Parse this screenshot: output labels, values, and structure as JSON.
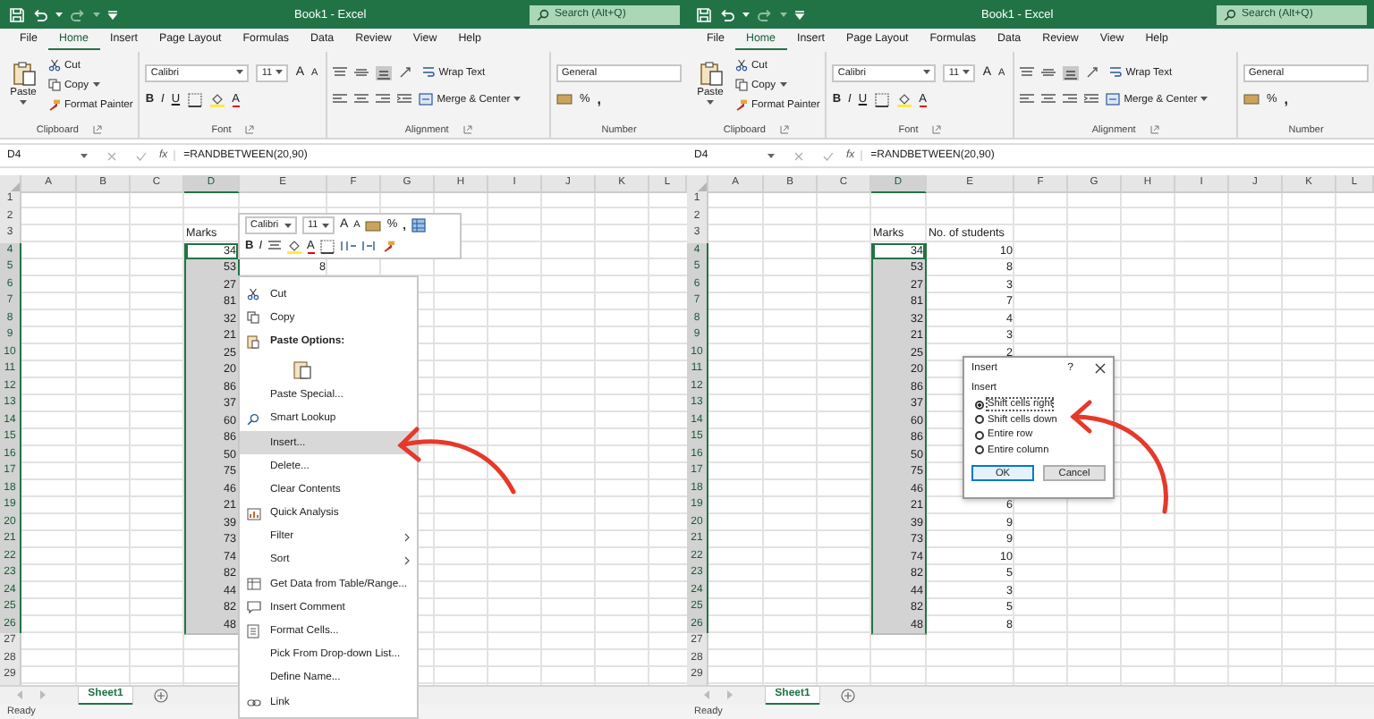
{
  "panes": [
    {
      "title_bar": {
        "title": "Book1 - Excel",
        "search": {
          "placeholder": "Search (Alt+Q)"
        }
      },
      "ribbon_tabs": [
        {
          "label": "File",
          "selected": false
        },
        {
          "label": "Home",
          "selected": true
        },
        {
          "label": "Insert",
          "selected": false
        },
        {
          "label": "Page Layout",
          "selected": false
        },
        {
          "label": "Formulas",
          "selected": false
        },
        {
          "label": "Data",
          "selected": false
        },
        {
          "label": "Review",
          "selected": false
        },
        {
          "label": "View",
          "selected": false
        },
        {
          "label": "Help",
          "selected": false
        }
      ],
      "ribbon": {
        "groups": [
          {
            "kind": "clipboard",
            "label": "Clipboard",
            "paste": "Paste",
            "commands": [
              "Cut",
              "Copy",
              "Format Painter"
            ]
          },
          {
            "kind": "font",
            "label": "Font",
            "font_name": "Calibri",
            "font_size": "11",
            "grow": "A",
            "shrink": "A",
            "styles": [
              "B",
              "I",
              "U"
            ],
            "color_letter": "A"
          },
          {
            "kind": "alignment",
            "label": "Alignment",
            "wrap": "Wrap Text",
            "merge": "Merge & Center"
          },
          {
            "kind": "number",
            "label": "Number",
            "format": "General",
            "percent": "%",
            "comma": ","
          }
        ]
      },
      "formula_bar": {
        "name_box": "D4",
        "function_label": "fx",
        "formula": "=RANDBETWEEN(20,90)"
      },
      "grid": {
        "columns": [
          {
            "label": "A",
            "selected": false
          },
          {
            "label": "B",
            "selected": false
          },
          {
            "label": "C",
            "selected": false
          },
          {
            "label": "D",
            "selected": true
          },
          {
            "label": "E",
            "selected": false
          },
          {
            "label": "F",
            "selected": false
          },
          {
            "label": "G",
            "selected": false
          },
          {
            "label": "H",
            "selected": false
          },
          {
            "label": "I",
            "selected": false
          },
          {
            "label": "J",
            "selected": false
          },
          {
            "label": "K",
            "selected": false
          },
          {
            "label": "L",
            "selected": false
          }
        ],
        "rows": [
          {
            "label": "1",
            "selected": false
          },
          {
            "label": "2",
            "selected": false
          },
          {
            "label": "3",
            "selected": false,
            "d": {
              "kind": "text",
              "text": "Marks",
              "selected": false,
              "active": false
            }
          },
          {
            "label": "4",
            "selected": true,
            "d": {
              "kind": "number",
              "text": "34",
              "selected": true,
              "active": true
            }
          },
          {
            "label": "5",
            "selected": true,
            "d": {
              "kind": "number",
              "text": "53",
              "selected": true,
              "active": false
            },
            "e": {
              "kind": "number",
              "text": "8"
            }
          },
          {
            "label": "6",
            "selected": true,
            "d": {
              "kind": "number",
              "text": "27",
              "selected": true,
              "active": false
            }
          },
          {
            "label": "7",
            "selected": true,
            "d": {
              "kind": "number",
              "text": "81",
              "selected": true,
              "active": false
            }
          },
          {
            "label": "8",
            "selected": true,
            "d": {
              "kind": "number",
              "text": "32",
              "selected": true,
              "active": false
            }
          },
          {
            "label": "9",
            "selected": true,
            "d": {
              "kind": "number",
              "text": "21",
              "selected": true,
              "active": false
            }
          },
          {
            "label": "10",
            "selected": true,
            "d": {
              "kind": "number",
              "text": "25",
              "selected": true,
              "active": false
            }
          },
          {
            "label": "11",
            "selected": true,
            "d": {
              "kind": "number",
              "text": "20",
              "selected": true,
              "active": false
            }
          },
          {
            "label": "12",
            "selected": true,
            "d": {
              "kind": "number",
              "text": "86",
              "selected": true,
              "active": false
            }
          },
          {
            "label": "13",
            "selected": true,
            "d": {
              "kind": "number",
              "text": "37",
              "selected": true,
              "active": false
            }
          },
          {
            "label": "14",
            "selected": true,
            "d": {
              "kind": "number",
              "text": "60",
              "selected": true,
              "active": false
            }
          },
          {
            "label": "15",
            "selected": true,
            "d": {
              "kind": "number",
              "text": "86",
              "selected": true,
              "active": false
            }
          },
          {
            "label": "16",
            "selected": true,
            "d": {
              "kind": "number",
              "text": "50",
              "selected": true,
              "active": false
            }
          },
          {
            "label": "17",
            "selected": true,
            "d": {
              "kind": "number",
              "text": "75",
              "selected": true,
              "active": false
            }
          },
          {
            "label": "18",
            "selected": true,
            "d": {
              "kind": "number",
              "text": "46",
              "selected": true,
              "active": false
            }
          },
          {
            "label": "19",
            "selected": true,
            "d": {
              "kind": "number",
              "text": "21",
              "selected": true,
              "active": false
            }
          },
          {
            "label": "20",
            "selected": true,
            "d": {
              "kind": "number",
              "text": "39",
              "selected": true,
              "active": false
            }
          },
          {
            "label": "21",
            "selected": true,
            "d": {
              "kind": "number",
              "text": "73",
              "selected": true,
              "active": false
            }
          },
          {
            "label": "22",
            "selected": true,
            "d": {
              "kind": "number",
              "text": "74",
              "selected": true,
              "active": false
            }
          },
          {
            "label": "23",
            "selected": true,
            "d": {
              "kind": "number",
              "text": "82",
              "selected": true,
              "active": false
            }
          },
          {
            "label": "24",
            "selected": true,
            "d": {
              "kind": "number",
              "text": "44",
              "selected": true,
              "active": false
            }
          },
          {
            "label": "25",
            "selected": true,
            "d": {
              "kind": "number",
              "text": "82",
              "selected": true,
              "active": false
            }
          },
          {
            "label": "26",
            "selected": true,
            "d": {
              "kind": "number",
              "text": "48",
              "selected": true,
              "active": false
            }
          },
          {
            "label": "27",
            "selected": false
          },
          {
            "label": "28",
            "selected": false
          },
          {
            "label": "29",
            "selected": false
          }
        ]
      },
      "sheet_tabs": [
        {
          "label": "Sheet1",
          "selected": true
        }
      ],
      "status_bar": "Ready",
      "mini_toolbar": {
        "font_name": "Calibri",
        "font_size": "11",
        "grow": "A",
        "shrink": "A",
        "percent": "%",
        "comma": ",",
        "bold": "B",
        "italic": "I",
        "color_letter": "A"
      },
      "context_menu": {
        "items": [
          {
            "kind": "scissors",
            "label": "Cut",
            "selected": false,
            "submenu": false
          },
          {
            "kind": "pages",
            "label": "Copy",
            "selected": false,
            "submenu": false
          },
          {
            "kind": "header",
            "label": "Paste Options:",
            "selected": false,
            "submenu": false
          },
          {
            "kind": "paste",
            "selected": false,
            "submenu": false
          },
          {
            "kind": "plain",
            "label": "Paste Special...",
            "selected": false,
            "submenu": false
          },
          {
            "kind": "magnifier",
            "label": "Smart Lookup",
            "selected": false,
            "submenu": false
          },
          {
            "kind": "plain",
            "label": "Insert...",
            "selected": true,
            "submenu": false
          },
          {
            "kind": "plain",
            "label": "Delete...",
            "selected": false,
            "submenu": false
          },
          {
            "kind": "plain",
            "label": "Clear Contents",
            "selected": false,
            "submenu": false
          },
          {
            "kind": "chart",
            "label": "Quick Analysis",
            "selected": false,
            "submenu": false
          },
          {
            "kind": "plain",
            "label": "Filter",
            "selected": false,
            "submenu": true
          },
          {
            "kind": "plain",
            "label": "Sort",
            "selected": false,
            "submenu": true
          },
          {
            "kind": "table",
            "label": "Get Data from Table/Range...",
            "selected": false,
            "submenu": false
          },
          {
            "kind": "comment",
            "label": "Insert Comment",
            "selected": false,
            "submenu": false
          },
          {
            "kind": "form",
            "label": "Format Cells...",
            "selected": false,
            "submenu": false
          },
          {
            "kind": "plain",
            "label": "Pick From Drop-down List...",
            "selected": false,
            "submenu": false
          },
          {
            "kind": "plain",
            "label": "Define Name...",
            "selected": false,
            "submenu": false
          },
          {
            "kind": "chain",
            "label": "Link",
            "selected": false,
            "submenu": false
          }
        ]
      }
    },
    {
      "title_bar": {
        "title": "Book1 - Excel",
        "search": {
          "placeholder": "Search (Alt+Q)"
        }
      },
      "ribbon_tabs": [
        {
          "label": "File",
          "selected": false
        },
        {
          "label": "Home",
          "selected": true
        },
        {
          "label": "Insert",
          "selected": false
        },
        {
          "label": "Page Layout",
          "selected": false
        },
        {
          "label": "Formulas",
          "selected": false
        },
        {
          "label": "Data",
          "selected": false
        },
        {
          "label": "Review",
          "selected": false
        },
        {
          "label": "View",
          "selected": false
        },
        {
          "label": "Help",
          "selected": false
        }
      ],
      "ribbon": {
        "groups": [
          {
            "kind": "clipboard",
            "label": "Clipboard",
            "paste": "Paste",
            "commands": [
              "Cut",
              "Copy",
              "Format Painter"
            ]
          },
          {
            "kind": "font",
            "label": "Font",
            "font_name": "Calibri",
            "font_size": "11",
            "grow": "A",
            "shrink": "A",
            "styles": [
              "B",
              "I",
              "U"
            ],
            "color_letter": "A"
          },
          {
            "kind": "alignment",
            "label": "Alignment",
            "wrap": "Wrap Text",
            "merge": "Merge & Center"
          },
          {
            "kind": "number",
            "label": "Number",
            "format": "General",
            "percent": "%",
            "comma": ","
          }
        ]
      },
      "formula_bar": {
        "name_box": "D4",
        "function_label": "fx",
        "formula": "=RANDBETWEEN(20,90)"
      },
      "grid": {
        "columns": [
          {
            "label": "A",
            "selected": false
          },
          {
            "label": "B",
            "selected": false
          },
          {
            "label": "C",
            "selected": false
          },
          {
            "label": "D",
            "selected": true
          },
          {
            "label": "E",
            "selected": false
          },
          {
            "label": "F",
            "selected": false
          },
          {
            "label": "G",
            "selected": false
          },
          {
            "label": "H",
            "selected": false
          },
          {
            "label": "I",
            "selected": false
          },
          {
            "label": "J",
            "selected": false
          },
          {
            "label": "K",
            "selected": false
          },
          {
            "label": "L",
            "selected": false
          }
        ],
        "rows": [
          {
            "label": "1",
            "selected": false
          },
          {
            "label": "2",
            "selected": false
          },
          {
            "label": "3",
            "selected": false,
            "d": {
              "kind": "text",
              "text": "Marks",
              "selected": false,
              "active": false
            },
            "e": {
              "kind": "text",
              "text": "No. of students"
            }
          },
          {
            "label": "4",
            "selected": true,
            "d": {
              "kind": "number",
              "text": "34",
              "selected": true,
              "active": true
            },
            "e": {
              "kind": "number",
              "text": "10"
            }
          },
          {
            "label": "5",
            "selected": true,
            "d": {
              "kind": "number",
              "text": "53",
              "selected": true,
              "active": false
            },
            "e": {
              "kind": "number",
              "text": "8"
            }
          },
          {
            "label": "6",
            "selected": true,
            "d": {
              "kind": "number",
              "text": "27",
              "selected": true,
              "active": false
            },
            "e": {
              "kind": "number",
              "text": "3"
            }
          },
          {
            "label": "7",
            "selected": true,
            "d": {
              "kind": "number",
              "text": "81",
              "selected": true,
              "active": false
            },
            "e": {
              "kind": "number",
              "text": "7"
            }
          },
          {
            "label": "8",
            "selected": true,
            "d": {
              "kind": "number",
              "text": "32",
              "selected": true,
              "active": false
            },
            "e": {
              "kind": "number",
              "text": "4"
            }
          },
          {
            "label": "9",
            "selected": true,
            "d": {
              "kind": "number",
              "text": "21",
              "selected": true,
              "active": false
            },
            "e": {
              "kind": "number",
              "text": "3"
            }
          },
          {
            "label": "10",
            "selected": true,
            "d": {
              "kind": "number",
              "text": "25",
              "selected": true,
              "active": false
            },
            "e": {
              "kind": "number",
              "text": "2"
            }
          },
          {
            "label": "11",
            "selected": true,
            "d": {
              "kind": "number",
              "text": "20",
              "selected": true,
              "active": false
            }
          },
          {
            "label": "12",
            "selected": true,
            "d": {
              "kind": "number",
              "text": "86",
              "selected": true,
              "active": false
            }
          },
          {
            "label": "13",
            "selected": true,
            "d": {
              "kind": "number",
              "text": "37",
              "selected": true,
              "active": false
            }
          },
          {
            "label": "14",
            "selected": true,
            "d": {
              "kind": "number",
              "text": "60",
              "selected": true,
              "active": false
            }
          },
          {
            "label": "15",
            "selected": true,
            "d": {
              "kind": "number",
              "text": "86",
              "selected": true,
              "active": false
            }
          },
          {
            "label": "16",
            "selected": true,
            "d": {
              "kind": "number",
              "text": "50",
              "selected": true,
              "active": false
            }
          },
          {
            "label": "17",
            "selected": true,
            "d": {
              "kind": "number",
              "text": "75",
              "selected": true,
              "active": false
            }
          },
          {
            "label": "18",
            "selected": true,
            "d": {
              "kind": "number",
              "text": "46",
              "selected": true,
              "active": false
            }
          },
          {
            "label": "19",
            "selected": true,
            "d": {
              "kind": "number",
              "text": "21",
              "selected": true,
              "active": false
            },
            "e": {
              "kind": "number",
              "text": "6"
            }
          },
          {
            "label": "20",
            "selected": true,
            "d": {
              "kind": "number",
              "text": "39",
              "selected": true,
              "active": false
            },
            "e": {
              "kind": "number",
              "text": "9"
            }
          },
          {
            "label": "21",
            "selected": true,
            "d": {
              "kind": "number",
              "text": "73",
              "selected": true,
              "active": false
            },
            "e": {
              "kind": "number",
              "text": "9"
            }
          },
          {
            "label": "22",
            "selected": true,
            "d": {
              "kind": "number",
              "text": "74",
              "selected": true,
              "active": false
            },
            "e": {
              "kind": "number",
              "text": "10"
            }
          },
          {
            "label": "23",
            "selected": true,
            "d": {
              "kind": "number",
              "text": "82",
              "selected": true,
              "active": false
            },
            "e": {
              "kind": "number",
              "text": "5"
            }
          },
          {
            "label": "24",
            "selected": true,
            "d": {
              "kind": "number",
              "text": "44",
              "selected": true,
              "active": false
            },
            "e": {
              "kind": "number",
              "text": "3"
            }
          },
          {
            "label": "25",
            "selected": true,
            "d": {
              "kind": "number",
              "text": "82",
              "selected": true,
              "active": false
            },
            "e": {
              "kind": "number",
              "text": "5"
            }
          },
          {
            "label": "26",
            "selected": true,
            "d": {
              "kind": "number",
              "text": "48",
              "selected": true,
              "active": false
            },
            "e": {
              "kind": "number",
              "text": "8"
            }
          },
          {
            "label": "27",
            "selected": false
          },
          {
            "label": "28",
            "selected": false
          },
          {
            "label": "29",
            "selected": false
          }
        ]
      },
      "sheet_tabs": [
        {
          "label": "Sheet1",
          "selected": true
        }
      ],
      "status_bar": "Ready",
      "dialog": {
        "title": "Insert",
        "help": "?",
        "group_label": "Insert",
        "options": [
          {
            "label": "Shift cells right",
            "selected": true
          },
          {
            "label": "Shift cells down",
            "selected": false
          },
          {
            "label": "Entire row",
            "selected": false
          },
          {
            "label": "Entire column",
            "selected": false
          }
        ],
        "buttons": [
          {
            "label": "OK",
            "focused": true
          },
          {
            "label": "Cancel",
            "focused": false
          }
        ]
      }
    }
  ]
}
